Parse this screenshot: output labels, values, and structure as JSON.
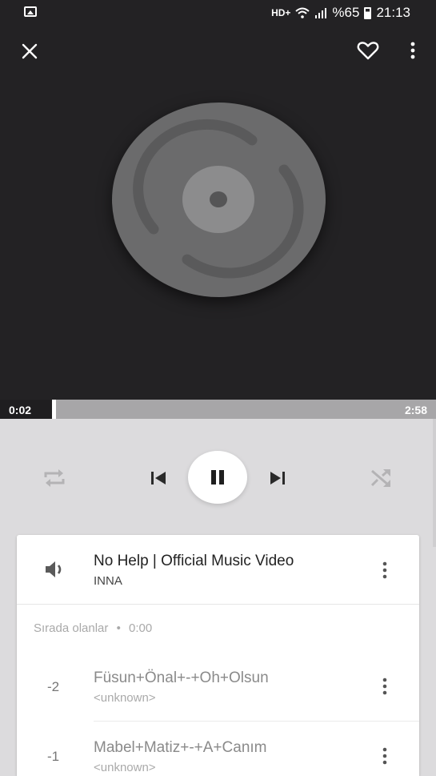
{
  "status_bar": {
    "network": "HD+",
    "battery": "%65",
    "time": "21:13"
  },
  "player": {
    "elapsed": "0:02",
    "duration": "2:58",
    "progress_fraction": 0.012
  },
  "now_playing": {
    "title": "No Help | Official Music Video",
    "artist": "INNA"
  },
  "queue": {
    "label": "Sırada olanlar",
    "separator": "•",
    "total_time": "0:00",
    "items": [
      {
        "position": "-2",
        "title": "Füsun+Önal+-+Oh+Olsun",
        "artist": "<unknown>"
      },
      {
        "position": "-1",
        "title": "Mabel+Matiz+-+A+Canım",
        "artist": "<unknown>"
      }
    ]
  },
  "icons": {
    "close": "close-icon",
    "favorite": "heart-outline-icon",
    "menu": "more-vert-icon",
    "repeat": "repeat-icon",
    "previous": "skip-previous-icon",
    "pause": "pause-icon",
    "next": "skip-next-icon",
    "shuffle": "shuffle-icon",
    "volume": "volume-icon"
  },
  "colors": {
    "header_bg": "#232224",
    "controls_bg": "#dcdbdd",
    "disc": "#6b6b6c"
  }
}
